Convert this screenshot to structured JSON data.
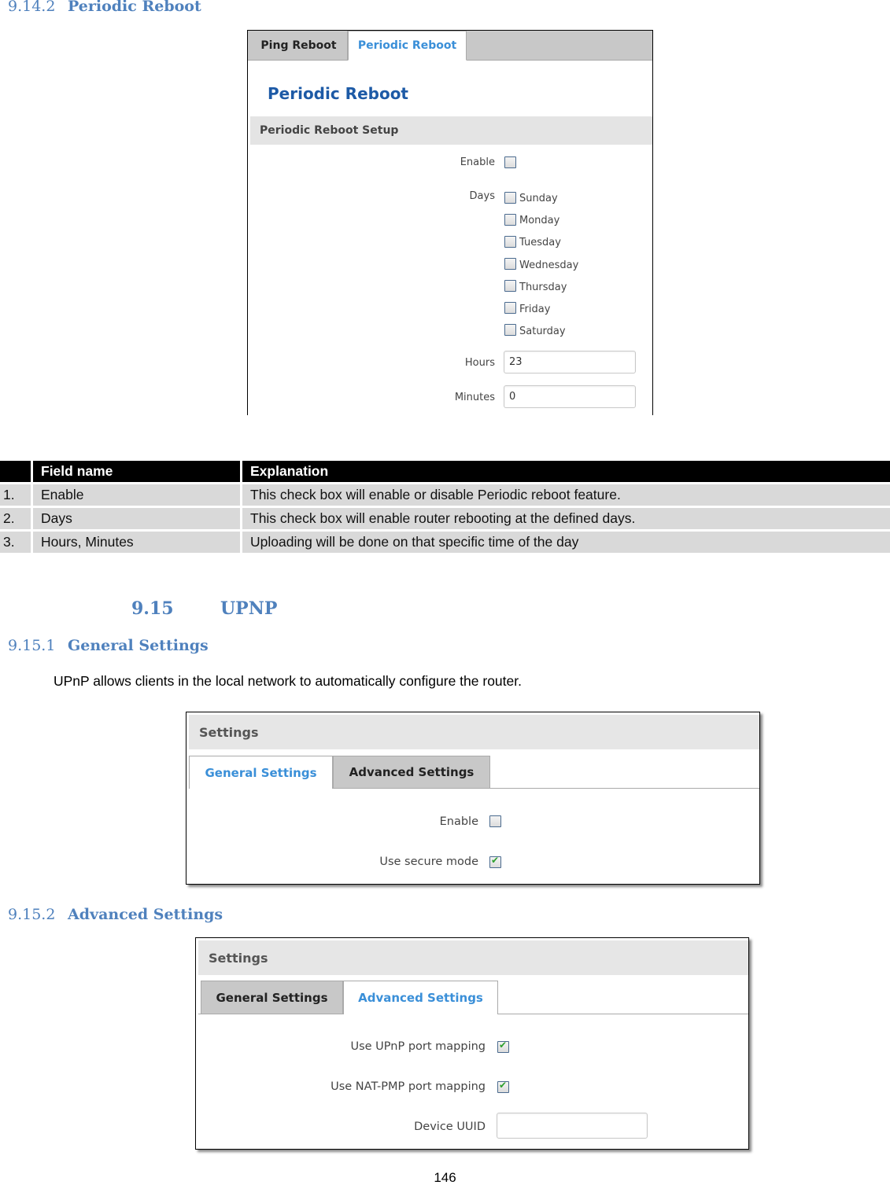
{
  "section_9_14_2": {
    "number": "9.14.2",
    "title": "Periodic Reboot"
  },
  "periodic_shot": {
    "tabs": [
      {
        "label": "Ping Reboot",
        "active": false
      },
      {
        "label": "Periodic Reboot",
        "active": true
      }
    ],
    "page_title": "Periodic Reboot",
    "section_title": "Periodic Reboot Setup",
    "enable": {
      "label": "Enable",
      "checked": false
    },
    "days": {
      "label": "Days",
      "options": [
        {
          "label": "Sunday",
          "checked": false
        },
        {
          "label": "Monday",
          "checked": false
        },
        {
          "label": "Tuesday",
          "checked": false
        },
        {
          "label": "Wednesday",
          "checked": false
        },
        {
          "label": "Thursday",
          "checked": false
        },
        {
          "label": "Friday",
          "checked": false
        },
        {
          "label": "Saturday",
          "checked": false
        }
      ]
    },
    "hours": {
      "label": "Hours",
      "value": "23"
    },
    "minutes": {
      "label": "Minutes",
      "value": "0"
    }
  },
  "field_table": {
    "headers": [
      "",
      "Field name",
      "Explanation"
    ],
    "rows": [
      [
        "1.",
        "Enable",
        "This check box will enable or disable Periodic reboot feature."
      ],
      [
        "2.",
        "Days",
        "This check box will enable router rebooting at the defined days."
      ],
      [
        "3.",
        "Hours, Minutes",
        "Uploading will be done on that specific time of the day"
      ]
    ]
  },
  "section_9_15": {
    "number": "9.15",
    "title": "UPNP"
  },
  "section_9_15_1": {
    "number": "9.15.1",
    "title": "General Settings",
    "description": "UPnP allows clients in the local network to automatically configure the router."
  },
  "general_shot": {
    "header": "Settings",
    "tabs": [
      {
        "label": "General Settings",
        "active": true
      },
      {
        "label": "Advanced Settings",
        "active": false
      }
    ],
    "enable": {
      "label": "Enable",
      "checked": false
    },
    "secure_mode": {
      "label": "Use secure mode",
      "checked": true
    }
  },
  "section_9_15_2": {
    "number": "9.15.2",
    "title": "Advanced Settings"
  },
  "advanced_shot": {
    "header": "Settings",
    "tabs": [
      {
        "label": "General Settings",
        "active": false
      },
      {
        "label": "Advanced Settings",
        "active": true
      }
    ],
    "upnp_mapping": {
      "label": "Use UPnP port mapping",
      "checked": true
    },
    "natpmp_mapping": {
      "label": "Use NAT-PMP port mapping",
      "checked": true
    },
    "device_uuid": {
      "label": "Device UUID",
      "value": ""
    }
  },
  "page_number": "146",
  "colors": {
    "heading": "#4f81bd",
    "active_tab": "#3a8fd8",
    "page_title": "#1d5aa6",
    "check": "#2ea02e"
  }
}
